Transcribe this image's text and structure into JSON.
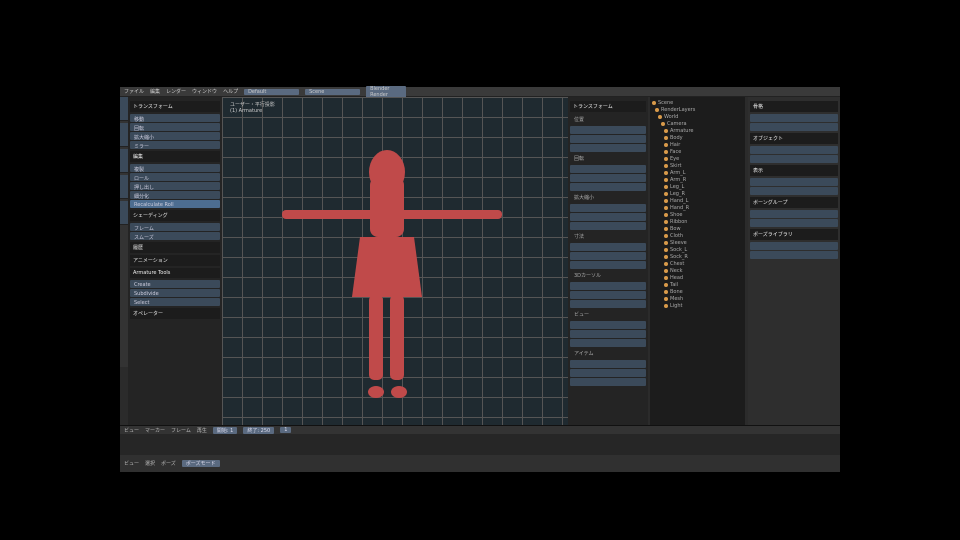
{
  "menubar": {
    "items": [
      "ファイル",
      "編集",
      "レンダー",
      "ウィンドウ",
      "ヘルプ"
    ],
    "layout": "Default",
    "scene": "Scene",
    "engine": "Blender Render"
  },
  "tool": {
    "sections": [
      {
        "title": "トランスフォーム",
        "items": [
          "移動",
          "回転",
          "拡大縮小",
          "ミラー"
        ]
      },
      {
        "title": "編集",
        "items": [
          "複製",
          "ロール",
          "押し出し",
          "細分化",
          "Recalculate Roll"
        ]
      },
      {
        "title": "シェーディング",
        "items": [
          "フレーム",
          "スムーズ"
        ]
      },
      {
        "title": "履歴",
        "items": []
      },
      {
        "title": "アニメーション",
        "items": []
      },
      {
        "title": "Armature Tools",
        "items": [
          "Create",
          "Subdivide",
          "Select"
        ]
      }
    ],
    "operator": "オペレーター"
  },
  "viewport": {
    "info1": "ユーザー・平行投影",
    "info2": "(1) Armature",
    "accent": "#c04a4a"
  },
  "npanel": {
    "title": "トランスフォーム",
    "sections": [
      "位置",
      "回転",
      "拡大縮小",
      "寸法",
      "3Dカーソル",
      "ビュー",
      "アイテム"
    ]
  },
  "outliner": {
    "items": [
      "Scene",
      "RenderLayers",
      "World",
      "Camera",
      "Armature",
      "Body",
      "Hair",
      "Face",
      "Eye",
      "Skirt",
      "Arm_L",
      "Arm_R",
      "Leg_L",
      "Leg_R",
      "Hand_L",
      "Hand_R",
      "Shoe",
      "Ribbon",
      "Bow",
      "Cloth",
      "Sleeve",
      "Sock_L",
      "Sock_R",
      "Chest",
      "Neck",
      "Head",
      "Tail",
      "Bone",
      "Mesh",
      "Light"
    ]
  },
  "props": {
    "sections": [
      "骨格",
      "オブジェクト",
      "表示",
      "ボーングループ",
      "ポーズライブラリ"
    ]
  },
  "timeline": {
    "items": [
      "ビュー",
      "マーカー",
      "フレーム",
      "再生"
    ],
    "start": "開始: 1",
    "end": "終了: 250",
    "current": "1"
  },
  "status": {
    "items": [
      "ビュー",
      "選択",
      "ポーズ"
    ],
    "mode": "ポーズモード"
  }
}
